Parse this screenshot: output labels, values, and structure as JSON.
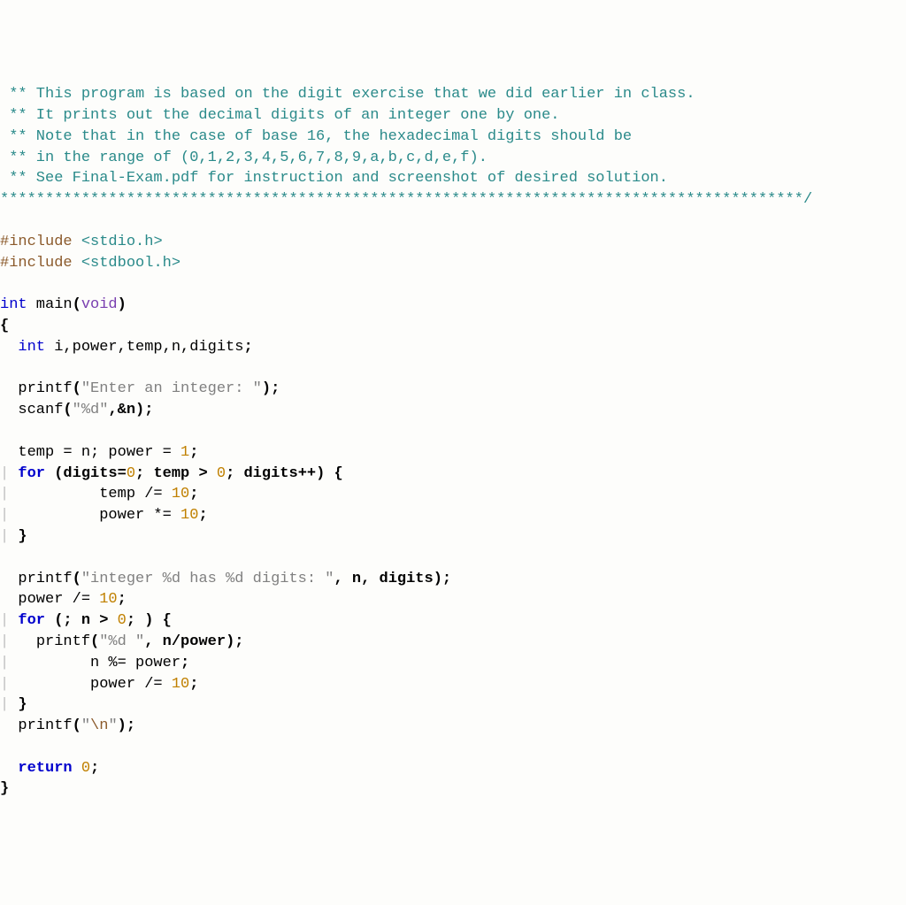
{
  "code": {
    "comment1": " ** This program is based on the digit exercise that we did earlier in class.",
    "comment2": " ** It prints out the decimal digits of an integer one by one.",
    "comment3": " ** Note that in the case of base 16, the hexadecimal digits should be",
    "comment4": " ** in the range of (0,1,2,3,4,5,6,7,8,9,a,b,c,d,e,f).",
    "comment5": " ** See Final-Exam.pdf for instruction and screenshot of desired solution.",
    "comment6": "*****************************************************************************************/",
    "include1_pre": "#include ",
    "include1_hdr": "<stdio.h>",
    "include2_pre": "#include ",
    "include2_hdr": "<stdbool.h>",
    "int": "int",
    "main": " main",
    "lparen": "(",
    "void": "void",
    "rparen_main": ")",
    "lbrace": "{",
    "decl_indent": "  ",
    "decl_rest": " i,power,temp,n,digits",
    "semi": ";",
    "printf": "printf",
    "str_enter": "\"Enter an integer: \"",
    "rparen_semi": ");",
    "scanf": "scanf",
    "str_pd": "\"%d\"",
    "comma_amp_n": ",&n",
    "temp_eq_n": "  temp = n; power = ",
    "one": "1",
    "for": "for",
    "for1_open": " (digits=",
    "zero": "0",
    "for1_mid": "; temp > ",
    "for1_end": "; digits++) {",
    "temp_div": "       temp /= ",
    "ten": "10",
    "power_mul": "       power *= ",
    "rbrace_ind": "  }",
    "str_has": "\"integer %d has %d digits: \"",
    "args_has": ", n, digits",
    "power_div": "  power /= ",
    "for2_open": " (; n > ",
    "for2_end": "; ) {",
    "str_pd_sp": "\"%d \"",
    "args_npow": ", n/power",
    "n_mod": "      n %= power",
    "power_div2": "      power /= ",
    "str_nl_open": "\"",
    "esc_n": "\\n",
    "str_nl_close": "\"",
    "return": "return",
    "space": " ",
    "rbrace": "}",
    "guide1": "| ",
    "guide2": "|   "
  }
}
